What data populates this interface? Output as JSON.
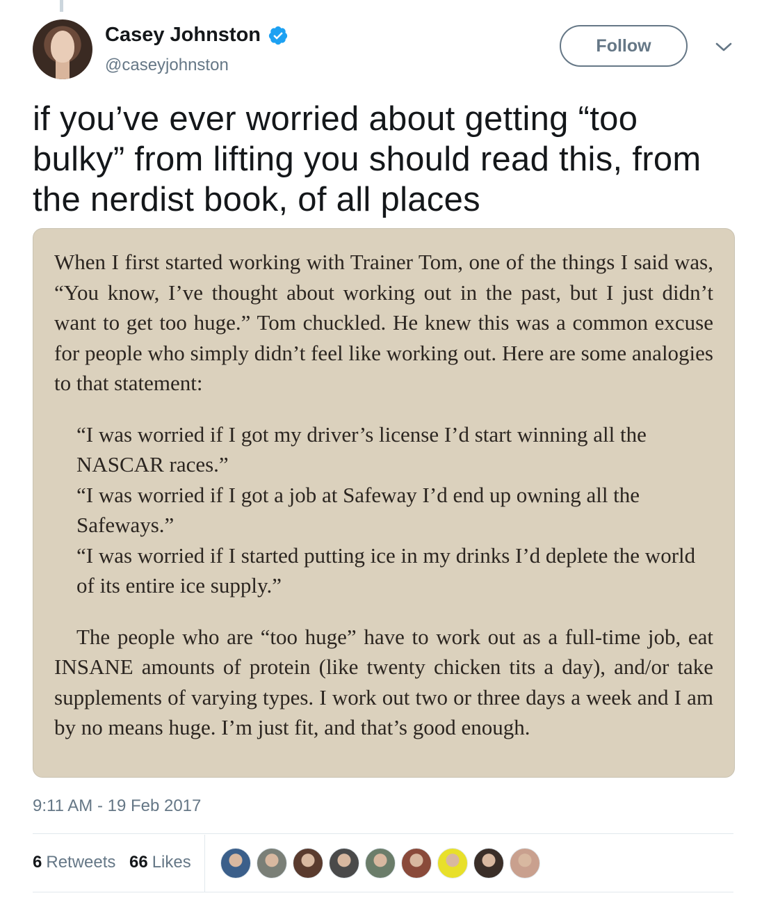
{
  "author": {
    "name": "Casey Johnston",
    "handle": "@caseyjohnston",
    "verified": true,
    "avatar_icon": "profile-photo"
  },
  "actions": {
    "follow_label": "Follow",
    "menu_icon": "chevron-down-icon"
  },
  "tweet": {
    "text": "if you’ve ever worried about getting “too bulky” from lifting you should read this, from the nerdist book, of all places"
  },
  "media": {
    "paragraph1": "When I first started working with Trainer Tom, one of the things I said was, “You know, I’ve thought about working out in the past, but I just didn’t want to get too huge.” Tom chuckled. He knew this was a common excuse for people who simply didn’t feel like working out. Here are some analogies to that statement:",
    "quotes": [
      "“I was worried if I got my driver’s license I’d start winning all the NASCAR races.”",
      "“I was worried if I got a job at Safeway I’d end up owning all the Safeways.”",
      "“I was worried if I started putting ice in my drinks I’d deplete the world of its entire ice supply.”"
    ],
    "paragraph2": "The people who are “too huge” have to work out as a full-time job, eat INSANE amounts of protein (like twenty chicken tits a day), and/or take supplements of varying types. I work out two or three days a week and I am by no means huge. I’m just fit, and that’s good enough.",
    "background_color": "#dbd1bd"
  },
  "meta": {
    "timestamp": "9:11 AM - 19 Feb 2017"
  },
  "stats": {
    "retweets_count": "6",
    "retweets_label": "Retweets",
    "likes_count": "66",
    "likes_label": "Likes"
  },
  "likers": [
    {
      "name": "liker-avatar-1",
      "color": "#3b5f8a"
    },
    {
      "name": "liker-avatar-2",
      "color": "#7a7f77"
    },
    {
      "name": "liker-avatar-3",
      "color": "#5a3b2e"
    },
    {
      "name": "liker-avatar-4",
      "color": "#4a4a4a"
    },
    {
      "name": "liker-avatar-5",
      "color": "#6b7d6a"
    },
    {
      "name": "liker-avatar-6",
      "color": "#8a4a3a"
    },
    {
      "name": "liker-avatar-7",
      "color": "#e8e02a"
    },
    {
      "name": "liker-avatar-8",
      "color": "#3a2e28"
    },
    {
      "name": "liker-avatar-9",
      "color": "#c9a08e"
    }
  ],
  "colors": {
    "verified_blue": "#1da1f2",
    "secondary_text": "#657786",
    "primary_text": "#14171a"
  }
}
